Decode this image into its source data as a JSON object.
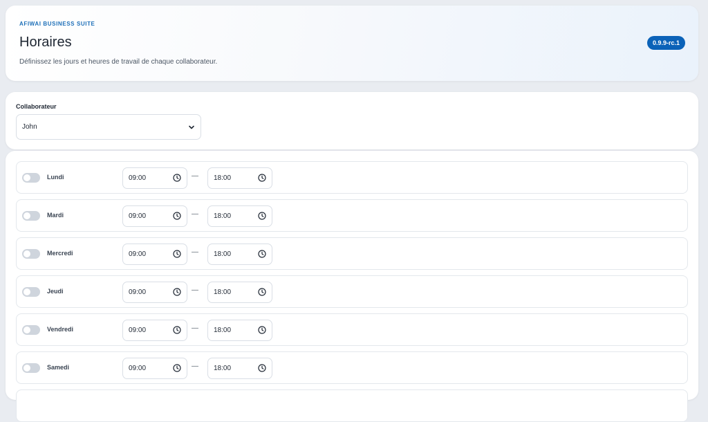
{
  "header": {
    "eyebrow": "AFIWAI BUSINESS SUITE",
    "title": "Horaires",
    "subtitle": "Définissez les jours et heures de travail de chaque collaborateur.",
    "version": "0.9.9-rc.1"
  },
  "collaborator": {
    "label": "Collaborateur",
    "selected": "John"
  },
  "schedule": {
    "separator": "—",
    "days": [
      {
        "label": "Lundi",
        "start": "09:00",
        "end": "18:00",
        "enabled": false
      },
      {
        "label": "Mardi",
        "start": "09:00",
        "end": "18:00",
        "enabled": false
      },
      {
        "label": "Mercredi",
        "start": "09:00",
        "end": "18:00",
        "enabled": false
      },
      {
        "label": "Jeudi",
        "start": "09:00",
        "end": "18:00",
        "enabled": false
      },
      {
        "label": "Vendredi",
        "start": "09:00",
        "end": "18:00",
        "enabled": false
      },
      {
        "label": "Samedi",
        "start": "09:00",
        "end": "18:00",
        "enabled": false
      }
    ]
  },
  "colors": {
    "accent": "#0b62b8",
    "eyebrow": "#1d6fb8",
    "toggle_off": "#cfd5dd"
  }
}
